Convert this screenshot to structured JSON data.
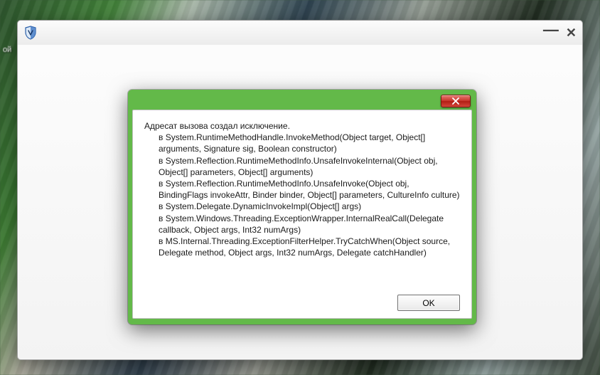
{
  "desktop": {
    "icon_label_fragment": "ой"
  },
  "app": {
    "icon_name": "shield-icon",
    "title": ""
  },
  "dialog": {
    "heading": "Адресат вызова создал исключение.",
    "stack": [
      "в System.RuntimeMethodHandle.InvokeMethod(Object target, Object[] arguments, Signature sig, Boolean constructor)",
      "в System.Reflection.RuntimeMethodInfo.UnsafeInvokeInternal(Object obj, Object[] parameters, Object[] arguments)",
      "в System.Reflection.RuntimeMethodInfo.UnsafeInvoke(Object obj, BindingFlags invokeAttr, Binder binder, Object[] parameters, CultureInfo culture)",
      "в System.Delegate.DynamicInvokeImpl(Object[] args)",
      "в System.Windows.Threading.ExceptionWrapper.InternalRealCall(Delegate callback, Object args, Int32 numArgs)",
      "в MS.Internal.Threading.ExceptionFilterHelper.TryCatchWhen(Object source, Delegate method, Object args, Int32 numArgs, Delegate catchHandler)"
    ],
    "ok_label": "OK"
  },
  "colors": {
    "dialog_frame": "#63b949",
    "close_red": "#c9362c"
  }
}
